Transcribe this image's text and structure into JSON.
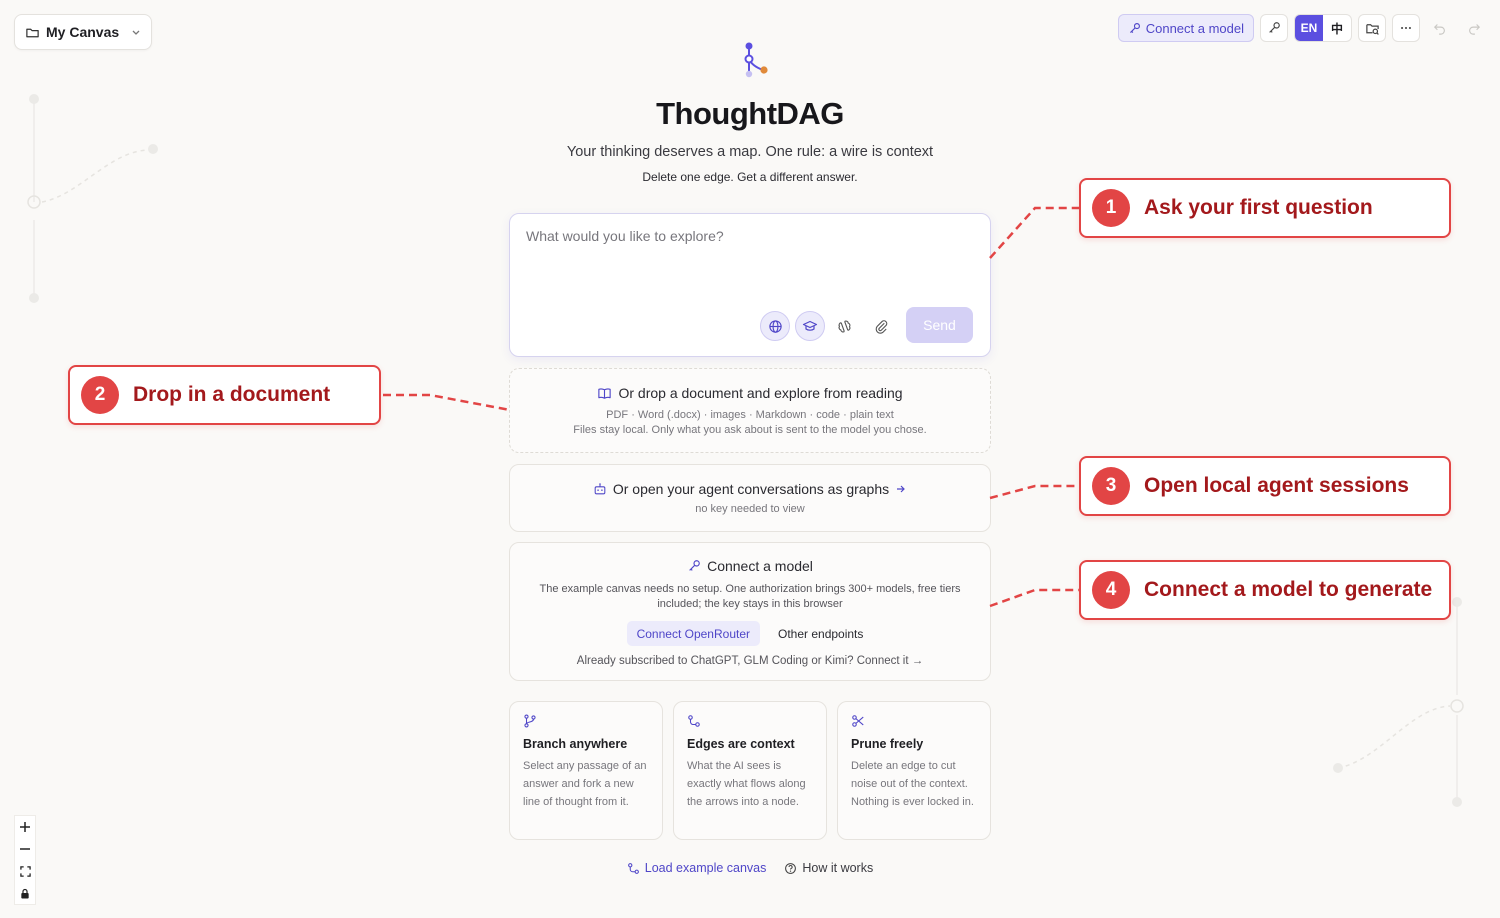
{
  "canvas_menu": {
    "label": "My Canvas"
  },
  "toolbar": {
    "connect_label": "Connect a model",
    "lang_en": "EN",
    "lang_zh": "中"
  },
  "hero": {
    "title": "ThoughtDAG",
    "subtitle": "Your thinking deserves a map. One rule: a wire is context",
    "subtitle2": "Delete one edge. Get a different answer."
  },
  "input": {
    "placeholder": "What would you like to explore?",
    "send_label": "Send"
  },
  "drop_zone": {
    "title": "Or drop a document and explore from reading",
    "formats": "PDF · Word (.docx) · images · Markdown · code · plain text",
    "privacy": "Files stay local. Only what you ask about is sent to the model you chose."
  },
  "agent_sessions": {
    "title": "Or open your agent conversations as graphs",
    "subtitle": "no key needed to view"
  },
  "connect_card": {
    "title": "Connect a model",
    "description": "The example canvas needs no setup. One authorization brings 300+ models, free tiers included; the key stays in this browser",
    "primary_button": "Connect OpenRouter",
    "secondary_button": "Other endpoints",
    "footer": "Already subscribed to ChatGPT, GLM Coding or Kimi? Connect it →"
  },
  "features": [
    {
      "title": "Branch anywhere",
      "text": "Select any passage of an answer and fork a new line of thought from it."
    },
    {
      "title": "Edges are context",
      "text": "What the AI sees is exactly what flows along the arrows into a node."
    },
    {
      "title": "Prune freely",
      "text": "Delete an edge to cut noise out of the context. Nothing is ever locked in."
    }
  ],
  "bottom_links": {
    "load_example": "Load example canvas",
    "how_it_works": "How it works"
  },
  "callouts": [
    {
      "num": "1",
      "text": "Ask your first question"
    },
    {
      "num": "2",
      "text": "Drop in a document"
    },
    {
      "num": "3",
      "text": "Open local agent sessions"
    },
    {
      "num": "4",
      "text": "Connect a model to generate"
    }
  ],
  "colors": {
    "accent": "#5b4fe0",
    "callout_red": "#e24545",
    "callout_text": "#a3191c"
  }
}
